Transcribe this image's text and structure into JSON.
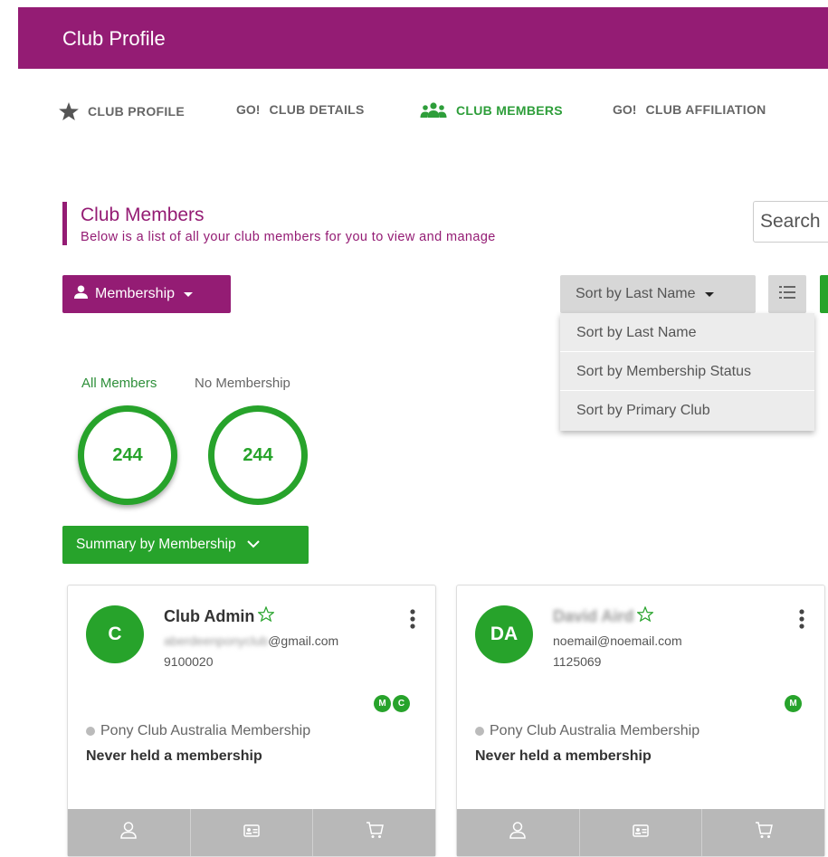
{
  "header": {
    "title": "Club Profile"
  },
  "tabs": [
    {
      "label": "CLUB PROFILE",
      "icon": "star-icon",
      "active": false
    },
    {
      "label": "CLUB DETAILS",
      "prefix": "GO!",
      "active": false
    },
    {
      "label": "CLUB MEMBERS",
      "icon": "users-icon",
      "active": true
    },
    {
      "label": "CLUB AFFILIATION",
      "prefix": "GO!",
      "active": false
    }
  ],
  "section": {
    "title": "Club Members",
    "subtitle": "Below is a list of all your club members for you to view and manage"
  },
  "search": {
    "placeholder": "Search"
  },
  "toolbar": {
    "membership_label": "Membership",
    "sort_label": "Sort by Last Name"
  },
  "sort_menu": {
    "options": [
      "Sort by Last Name",
      "Sort by Membership Status",
      "Sort by Primary Club"
    ]
  },
  "stats": [
    {
      "label": "All Members",
      "count": "244"
    },
    {
      "label": "No Membership",
      "count": "244"
    }
  ],
  "summary_button": {
    "label": "Summary by Membership"
  },
  "members": [
    {
      "initials": "C",
      "name": "Club  Admin",
      "email_hidden": "aberdeenponyclub",
      "email": "@gmail.com",
      "id": "9100020",
      "badges": [
        "M",
        "C"
      ],
      "membership_type": "Pony Club Australia Membership",
      "membership_status": "Never held a membership"
    },
    {
      "initials": "DA",
      "name": "David Aird",
      "email": "noemail@noemail.com",
      "id": "1125069",
      "badges": [
        "M"
      ],
      "membership_type": "Pony Club Australia Membership",
      "membership_status": "Never held a membership"
    }
  ],
  "colors": {
    "brand": "#941c74",
    "accent_green": "#27a32b",
    "sort_button": "#d7d7d7",
    "card_footer": "#b8b8b8"
  }
}
